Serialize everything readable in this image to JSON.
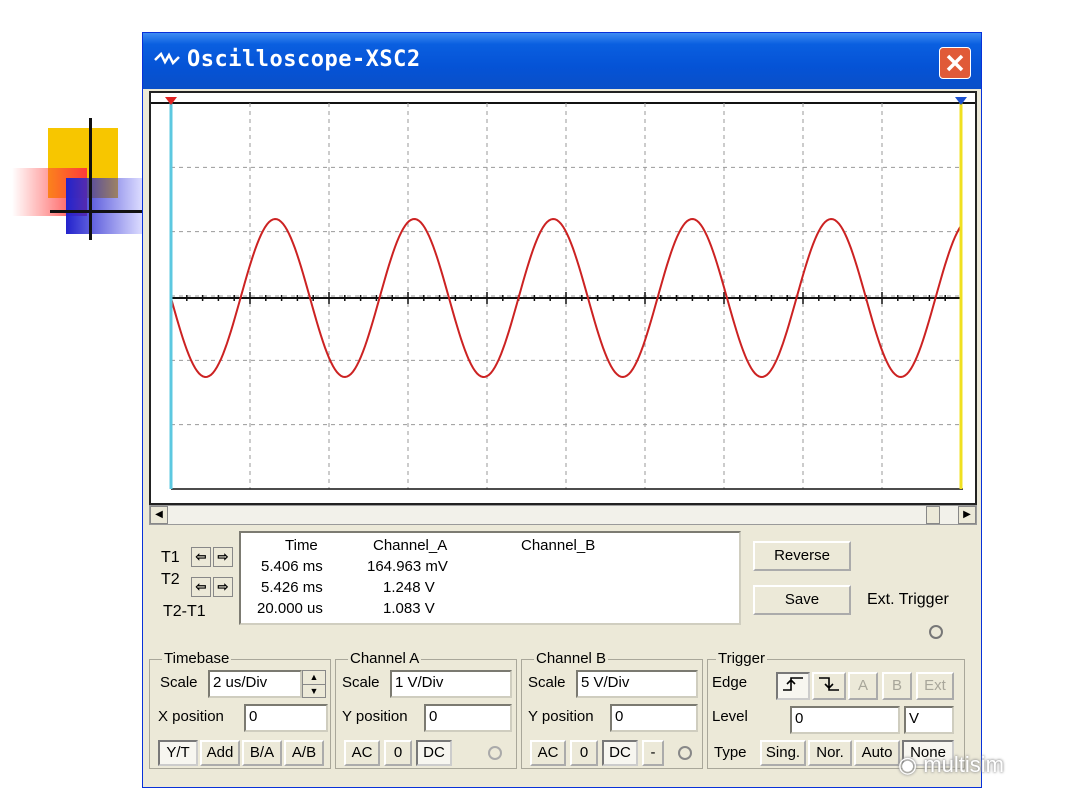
{
  "window": {
    "title": "Oscilloscope-XSC2",
    "close_icon": "close-icon"
  },
  "waveform": {
    "channel_a_color": "#cc2222",
    "cursor1_color": "#5cc8e0",
    "cursor2_color": "#f0e020"
  },
  "readout": {
    "headers": [
      "Time",
      "Channel_A",
      "Channel_B"
    ],
    "rows": [
      {
        "label": "T1",
        "time": "5.406 ms",
        "channel_a": "164.963 mV",
        "channel_b": ""
      },
      {
        "label": "T2",
        "time": "5.426 ms",
        "channel_a": "1.248 V",
        "channel_b": ""
      },
      {
        "label": "T2-T1",
        "time": "20.000 us",
        "channel_a": "1.083 V",
        "channel_b": ""
      }
    ]
  },
  "buttons": {
    "reverse": "Reverse",
    "save": "Save",
    "ext_trigger": "Ext. Trigger"
  },
  "timebase": {
    "title": "Timebase",
    "scale_label": "Scale",
    "scale_value": "2 us/Div",
    "xpos_label": "X position",
    "xpos_value": "0",
    "modes": [
      "Y/T",
      "Add",
      "B/A",
      "A/B"
    ]
  },
  "channel_a": {
    "title": "Channel A",
    "scale_label": "Scale",
    "scale_value": "1  V/Div",
    "ypos_label": "Y position",
    "ypos_value": "0",
    "coupling": [
      "AC",
      "0",
      "DC"
    ]
  },
  "channel_b": {
    "title": "Channel B",
    "scale_label": "Scale",
    "scale_value": "5  V/Div",
    "ypos_label": "Y position",
    "ypos_value": "0",
    "coupling": [
      "AC",
      "0",
      "DC",
      "-"
    ]
  },
  "trigger": {
    "title": "Trigger",
    "edge_label": "Edge",
    "sources": [
      "A",
      "B",
      "Ext"
    ],
    "level_label": "Level",
    "level_value": "0",
    "level_unit": "V",
    "type_label": "Type",
    "types": [
      "Sing.",
      "Nor.",
      "Auto",
      "None"
    ]
  },
  "watermark": "multisim"
}
